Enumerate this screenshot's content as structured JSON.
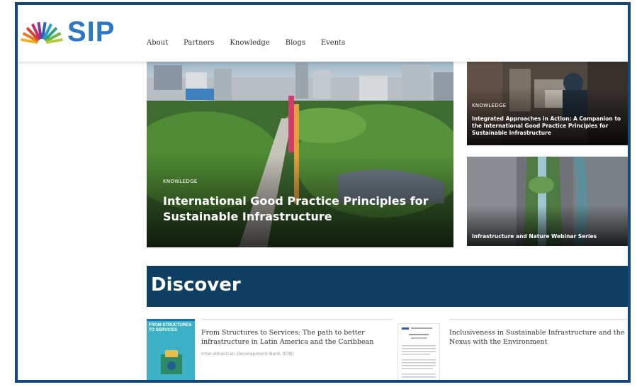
{
  "brand": {
    "logo_text": "SIP"
  },
  "nav": {
    "items": [
      "About",
      "Partners",
      "Knowledge",
      "Blogs",
      "Events"
    ]
  },
  "hero": {
    "tag": "KNOWLEDGE",
    "title": "International Good Practice Principles for Sustainable Infrastructure"
  },
  "side_cards": [
    {
      "tag": "KNOWLEDGE",
      "title": "Integrated Approaches in Action: A Companion to the International Good Practice Principles for Sustainable Infrastructure"
    },
    {
      "title": "Infrastructure and Nature Webinar Series"
    }
  ],
  "discover": {
    "heading": "Discover",
    "cards": [
      {
        "cover_text": "FROM STRUCTURES TO SERVICES",
        "title": "From Structures to Services: The path to better infrastructure in Latin America and the Caribbean",
        "subtitle": "Inter-American Development Bank (IDB)"
      },
      {
        "title": "Inclusiveness in Sustainable Infrastructure and the Nexus with the Environment"
      }
    ]
  },
  "colors": {
    "frame": "#15477f",
    "banner": "#0f3e63",
    "logo": "#2b78c7"
  }
}
